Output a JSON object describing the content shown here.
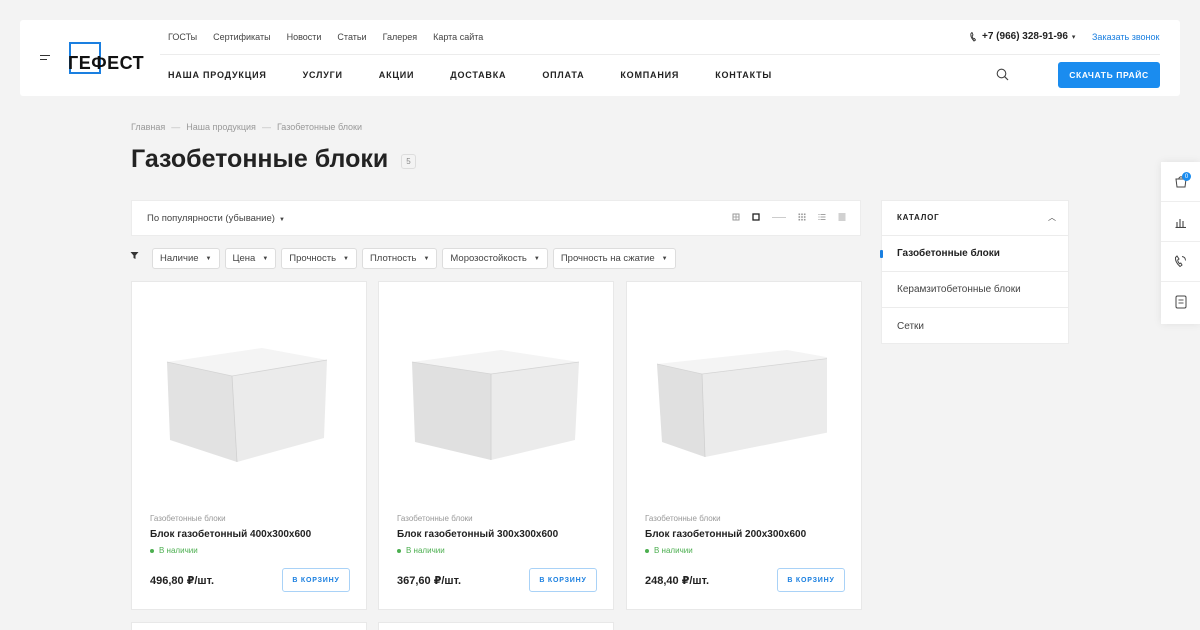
{
  "brand": {
    "name": "ГЕФЕСТ",
    "accent": "#1a8cef"
  },
  "top_links": [
    "ГОСТы",
    "Сертификаты",
    "Новости",
    "Статьи",
    "Галерея",
    "Карта сайта"
  ],
  "main_nav": [
    "НАША ПРОДУКЦИЯ",
    "УСЛУГИ",
    "АКЦИИ",
    "ДОСТАВКА",
    "ОПЛАТА",
    "КОМПАНИЯ",
    "КОНТАКТЫ"
  ],
  "header": {
    "phone": "+7 (966) 328-91-96",
    "callback_label": "Заказать звонок",
    "price_button": "СКАЧАТЬ ПРАЙС"
  },
  "breadcrumb": [
    "Главная",
    "Наша продукция",
    "Газобетонные блоки"
  ],
  "page": {
    "title": "Газобетонные блоки",
    "count": "5"
  },
  "sort": {
    "label": "По популярности (убывание)"
  },
  "filters": [
    "Наличие",
    "Цена",
    "Прочность",
    "Плотность",
    "Морозостойкость",
    "Прочность на сжатие"
  ],
  "products": [
    {
      "category": "Газобетонные блоки",
      "name": "Блок газобетонный 400х300х600",
      "stock": "В наличии",
      "price": "496,80 ₽/шт.",
      "cart_label": "В КОРЗИНУ"
    },
    {
      "category": "Газобетонные блоки",
      "name": "Блок газобетонный 300х300х600",
      "stock": "В наличии",
      "price": "367,60 ₽/шт.",
      "cart_label": "В КОРЗИНУ"
    },
    {
      "category": "Газобетонные блоки",
      "name": "Блок газобетонный 200х300х600",
      "stock": "В наличии",
      "price": "248,40 ₽/шт.",
      "cart_label": "В КОРЗИНУ"
    }
  ],
  "catalog": {
    "title": "КАТАЛОГ",
    "items": [
      "Газобетонные блоки",
      "Керамзитобетонные блоки",
      "Сетки"
    ]
  },
  "float_bar": {
    "cart_count": "0",
    "icons": [
      "cart-icon",
      "compare-icon",
      "phone-icon",
      "document-icon"
    ]
  }
}
